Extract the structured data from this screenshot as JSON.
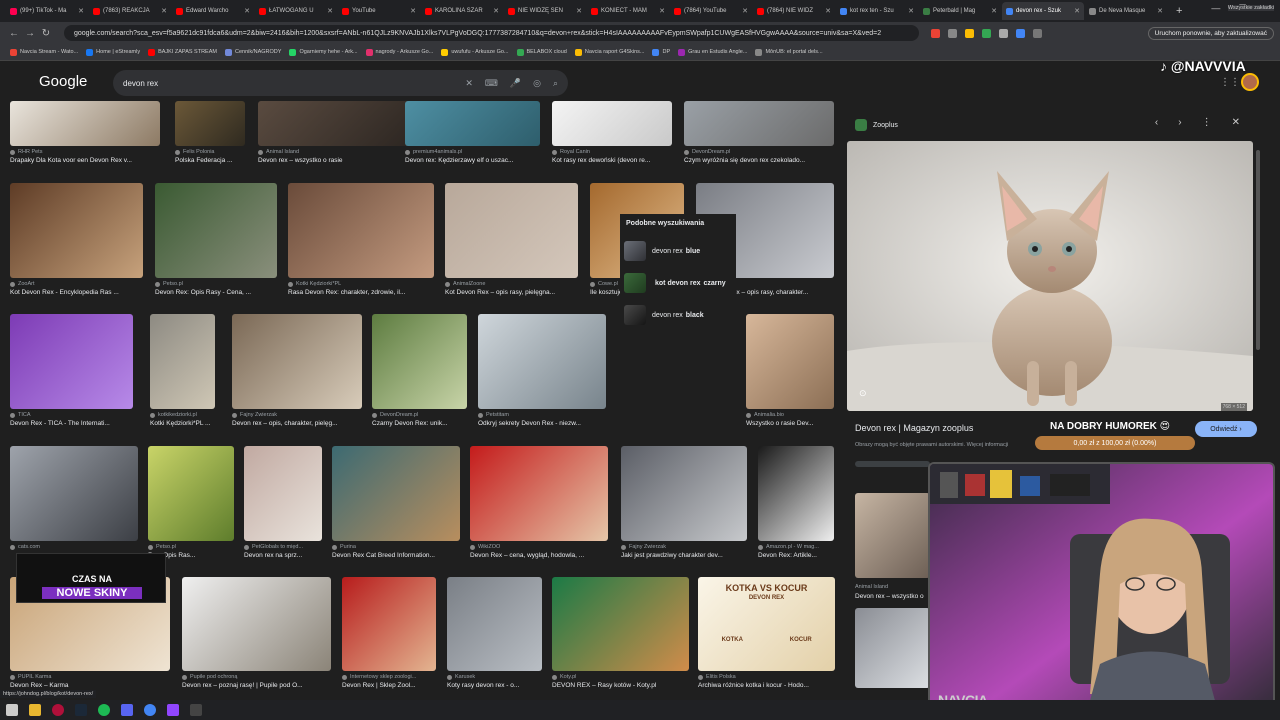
{
  "browser": {
    "tabs": [
      {
        "label": "(99+) TikTok - Ma",
        "color": "#ff0050"
      },
      {
        "label": "(7863) REAKCJA",
        "color": "#ff0000"
      },
      {
        "label": "Edward Warcho",
        "color": "#ff0000"
      },
      {
        "label": "ŁATWOGANG U",
        "color": "#ff0000"
      },
      {
        "label": "YouTube",
        "color": "#ff0000"
      },
      {
        "label": "KAROLINA SZAR",
        "color": "#ff0000"
      },
      {
        "label": "NIE WIDZĘ SEN",
        "color": "#ff0000"
      },
      {
        "label": "KONIECT - MAM",
        "color": "#ff0000"
      },
      {
        "label": "(7864) YouTube",
        "color": "#ff0000"
      },
      {
        "label": "(7864) NIE WIDZ",
        "color": "#ff0000"
      },
      {
        "label": "kot rex ten - Szu",
        "color": "#4285f4"
      },
      {
        "label": "Peterbald | Mag",
        "color": "#3a7d44"
      },
      {
        "label": "devon rex - Szuk",
        "color": "#4285f4",
        "active": true
      },
      {
        "label": "De Neva Masque",
        "color": "#888888"
      }
    ],
    "new_tab": "+",
    "url": "google.com/search?sca_esv=f5a9621dc91fdca6&udm=2&biw=2416&bih=1200&sxsrf=ANbL-n61QJLz9KNVAJb1Xlks7VLPgVoDGQ:1777387284710&q=devon+rex&stick=H4sIAAAAAAAAAFvEypmSWpafp1CUWgEASfHVGgwAAAA&source=univ&sa=X&ved=2",
    "update_btn": "Uruchom ponownie, aby zaktualizować",
    "bookmarks": [
      "Navcia Stream - Wato...",
      "Home | eStreamly",
      "BAJKI ZAPAS STREAM",
      "Cennik/NAGRODY",
      "Ogarniemy hehe - Ark...",
      "nagrody - Arkusze Go...",
      "uwufufu - Arkusze Go...",
      "BELABOX cloud",
      "Navcia raport G4Skins...",
      "DP",
      "Grau en Estudis Angle...",
      "MônUB: el portal dels..."
    ],
    "other_bookmarks": "Wszystkie zakładki"
  },
  "google": {
    "logo": "Google",
    "query": "devon rex"
  },
  "overlay_brand": "♪ @NAVVVIA",
  "grid": {
    "row0": [
      {
        "src": "RHR Pets",
        "cap": "Drapaky Dla Kota voor een Devon Rex v..."
      },
      {
        "src": "Felis Polonia",
        "cap": "Polska Federacja ..."
      },
      {
        "src": "Animal Island",
        "cap": "Devon rex – wszystko o rasie"
      },
      {
        "src": "premium4animals.pl",
        "cap": "Devon rex: Kędzierzawy elf o uszac..."
      },
      {
        "src": "Royal Canin",
        "cap": "Kot rasy rex dewoński (devon re..."
      },
      {
        "src": "DevonDream.pl",
        "cap": "Czym wyróżnia się devon rex czekolado..."
      }
    ],
    "row1": [
      {
        "src": "ZooArt",
        "cap": "Kot Devon Rex - Encyklopedia Ras ..."
      },
      {
        "src": "Petso.pl",
        "cap": "Devon Rex: Opis Rasy - Cena, ..."
      },
      {
        "src": "Kotki Kędziorki*PL",
        "cap": "Rasa Devon Rex: charakter, zdrowie, il..."
      },
      {
        "src": "AnimalZoone",
        "cap": "Kot Devon Rex – opis rasy, pielęgna..."
      },
      {
        "src": "Cowe.pl",
        "cap": "Ile kosztuje Devon Rex?..."
      },
      {
        "src": "John Dog",
        "cap": "Kot Devon Rex – opis rasy, charakter..."
      }
    ],
    "row2": [
      {
        "src": "TICA",
        "cap": "Devon Rex - TICA - The Internati..."
      },
      {
        "src": "kotkikedziorki.pl",
        "cap": "Kotki Kędziorki*PL ..."
      },
      {
        "src": "Fajny Zwierzak",
        "cap": "Devon rex – opis, charakter, pielęg..."
      },
      {
        "src": "DevonDream.pl",
        "cap": "Czarny Devon Rex: unik..."
      },
      {
        "src": "Petstitam",
        "cap": "Odkryj sekrety Devon Rex - niezw..."
      },
      {
        "src": "Animalia.bio",
        "cap": "Wszystko o rasie Dev..."
      }
    ],
    "row3": [
      {
        "src": "cats.com",
        "cap": ""
      },
      {
        "src": "Petso.pl",
        "cap": "Rex: Opis Ras..."
      },
      {
        "src": "PetGlobals to międ...",
        "cap": "Devon rex na sprz..."
      },
      {
        "src": "Purina",
        "cap": "Devon Rex Cat Breed Information..."
      },
      {
        "src": "WikiZOO",
        "cap": "Devon Rex – cena, wygląd, hodowla, ..."
      },
      {
        "src": "Fajny Zwierzak",
        "cap": "Jaki jest prawdziwy charakter dev..."
      },
      {
        "src": "Amazon.pl - W mag...",
        "cap": "Devon Rex: Artikle..."
      }
    ],
    "row4": [
      {
        "src": "PUPIL Karma",
        "cap": "Devon Rex – Karma"
      },
      {
        "src": "Pupile pod ochroną",
        "cap": "Devon rex – poznaj rasę! | Pupile pod O..."
      },
      {
        "src": "Internetowy sklep zoologi...",
        "cap": "Devon Rex | Sklep Zool..."
      },
      {
        "src": "Karusek",
        "cap": "Koty rasy devon rex - o..."
      },
      {
        "src": "Koty.pl",
        "cap": "DEVON REX – Rasy kotów - Koty.pl"
      },
      {
        "src": "Elitis Polska",
        "cap": "Archiwa różnice kotka i kocur - Hodo..."
      }
    ],
    "kotka_vs_kocur": {
      "title": "KOTKA VS KOCUR",
      "sub": "DEVON REX",
      "left": "KOTKA",
      "right": "KOCUR"
    }
  },
  "similar": {
    "title": "Podobne wyszukiwania",
    "items": [
      {
        "pre": "devon rex",
        "bold": "blue"
      },
      {
        "pre": "kot devon rex",
        "bold": "czarny"
      },
      {
        "pre": "devon rex",
        "bold": "black"
      }
    ]
  },
  "overlay_cta": {
    "line1": "CZAS NA",
    "line2": "NOWE SKINY"
  },
  "status_url": "https://johndog.pl/blog/kot/devon-rex/",
  "panel": {
    "site": "Zooplus",
    "title": "Devon rex | Magazyn zooplus",
    "desc": "Obrazy mogą być objęte prawami autorskimi. Więcej informacji",
    "visit": "Odwiedź",
    "dims": "768 × 512",
    "humor": "NA DOBRY HUMOREK 😍",
    "goal": "0,00 zł z 100,00 zł (0.00%)",
    "tile1_src": "Animal Island",
    "tile1_cap": "Devon rex – wszystko o"
  },
  "webcam_name": "NAVCIA"
}
